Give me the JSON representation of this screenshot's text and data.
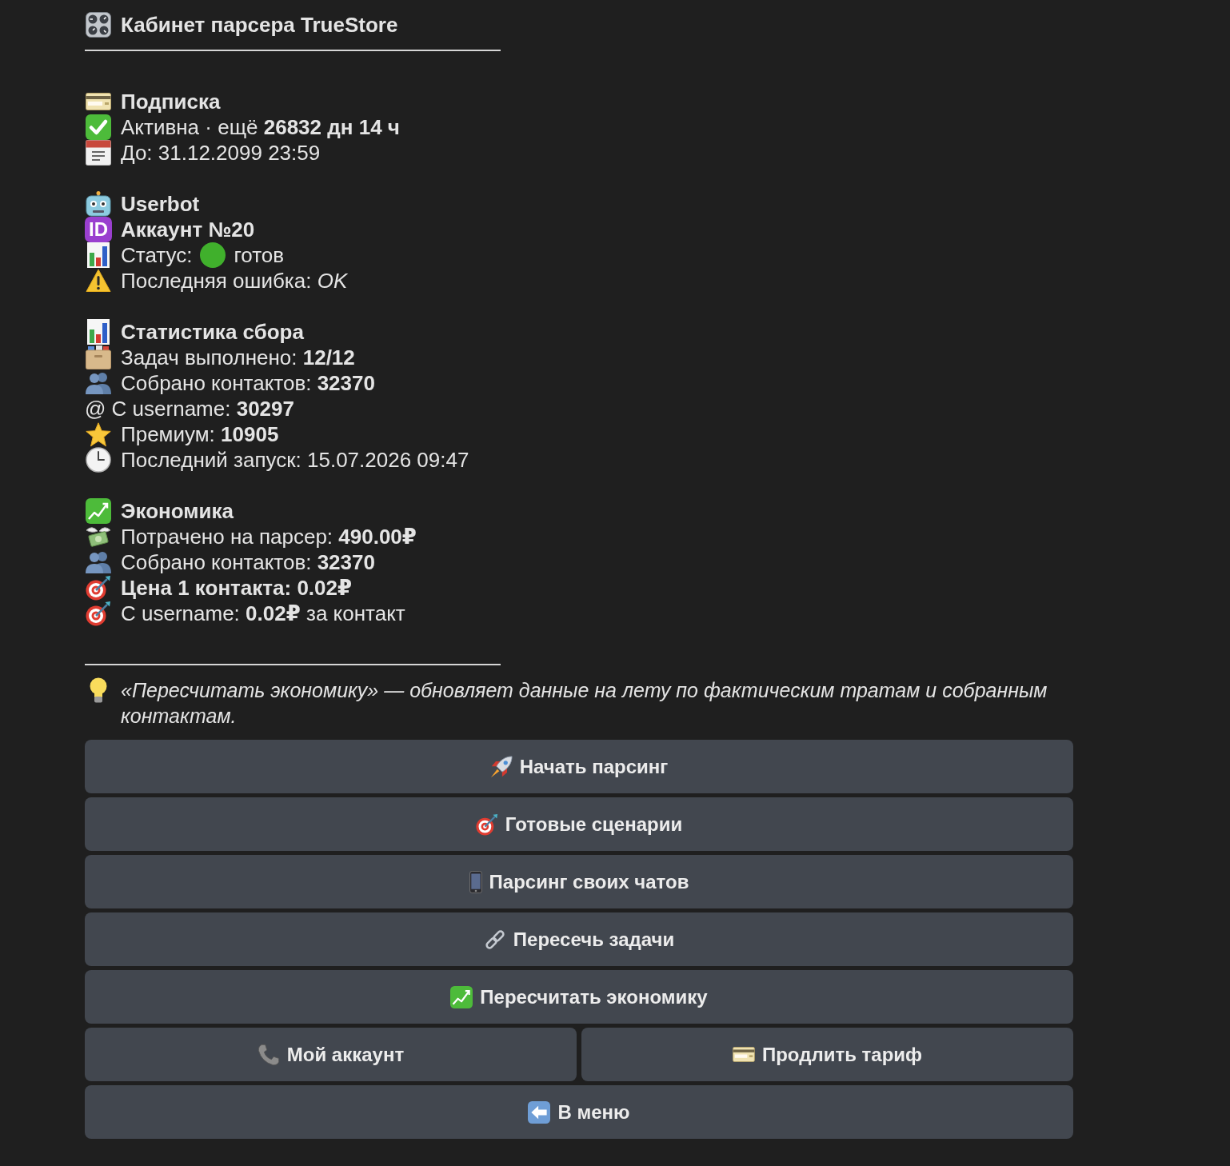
{
  "header": {
    "title": "Кабинет парсера TrueStore"
  },
  "sections": [
    {
      "title": {
        "kind": "subscription",
        "text": "Подписка"
      },
      "lines": [
        {
          "kind": "active",
          "text": "Активна · ещё **26832 дн 14 ч**",
          "bold": false
        },
        {
          "kind": "expiry",
          "text": "До: 31.12.2099 23:59",
          "bold": false
        }
      ]
    },
    {
      "title": {
        "kind": "userbot",
        "text": "Userbot"
      },
      "lines": [
        {
          "kind": "account",
          "badge": "ID",
          "text": "Аккаунт №20",
          "bold": true
        },
        {
          "kind": "status",
          "text": "Статус:",
          "status": {
            "label": "готов",
            "color": "#40b02c"
          },
          "bold": false
        },
        {
          "kind": "error",
          "text": "Последняя ошибка: *OK*",
          "bold": false
        }
      ]
    },
    {
      "title": {
        "kind": "stats",
        "text": "Статистика сбора"
      },
      "lines": [
        {
          "kind": "tasks",
          "text": "Задач выполнено: **12/12**",
          "bold": false
        },
        {
          "kind": "contacts",
          "text": "Собрано контактов: **32370**",
          "bold": false
        },
        {
          "kind": "username",
          "text": "@ С username: **30297**",
          "bold": false
        },
        {
          "kind": "premium",
          "text": "Премиум: **10905**",
          "bold": false
        },
        {
          "kind": "lastrun",
          "text": "Последний запуск: 15.07.2026 09:47",
          "bold": false
        }
      ]
    },
    {
      "title": {
        "kind": "economy",
        "text": "Экономика"
      },
      "lines": [
        {
          "kind": "spent",
          "text": "Потрачено на парсер: **490.00₽**",
          "bold": false
        },
        {
          "kind": "contacts",
          "text": "Собрано контактов: **32370**",
          "bold": false
        },
        {
          "kind": "price",
          "text": "Цена 1 контакта: 0.02₽",
          "bold": true
        },
        {
          "kind": "price",
          "text": "С username: **0.02₽** за контакт",
          "bold": false
        }
      ]
    }
  ],
  "note": {
    "text": "«Пересчитать экономику» — обновляет данные на лету по фактическим тратам и собранным контактам."
  },
  "keyboard": [
    {
      "buttons": [
        {
          "kind": "start",
          "label": "Начать парсинг"
        }
      ]
    },
    {
      "buttons": [
        {
          "kind": "scenarios",
          "label": "Готовые сценарии"
        }
      ]
    },
    {
      "buttons": [
        {
          "kind": "chats",
          "label": "Парсинг своих чатов"
        }
      ]
    },
    {
      "buttons": [
        {
          "kind": "intersect",
          "label": "Пересечь задачи"
        }
      ]
    },
    {
      "buttons": [
        {
          "kind": "recalc",
          "label": "Пересчитать экономику"
        }
      ]
    },
    {
      "buttons": [
        {
          "kind": "account",
          "label": "Мой аккаунт"
        },
        {
          "kind": "renew",
          "label": "Продлить тариф"
        }
      ]
    },
    {
      "buttons": [
        {
          "kind": "menu",
          "label": "В меню"
        }
      ]
    }
  ]
}
